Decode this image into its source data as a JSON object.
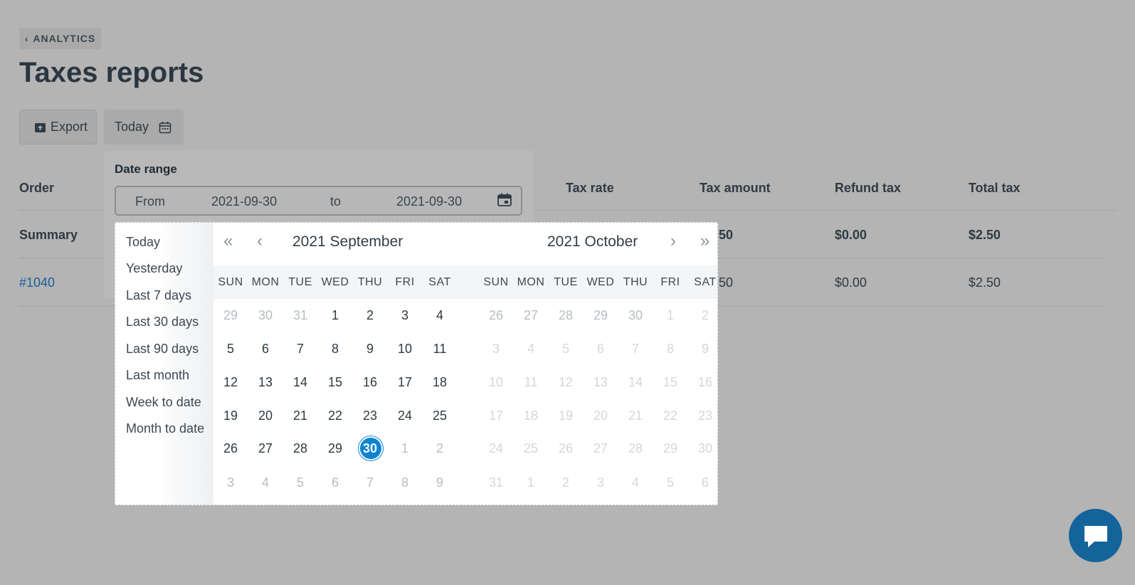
{
  "breadcrumb": {
    "label": "ANALYTICS"
  },
  "title": "Taxes reports",
  "toolbar": {
    "export_label": "Export",
    "date_button_label": "Today"
  },
  "table": {
    "headers": {
      "order": "Order",
      "tax_rate": "Tax rate",
      "tax_amount": "Tax amount",
      "refund_tax": "Refund tax",
      "total_tax": "Total tax"
    },
    "summary": {
      "label": "Summary",
      "tax_amount_partial": "50",
      "refund_tax": "$0.00",
      "total_tax": "$2.50"
    },
    "rows": [
      {
        "order": "#1040",
        "tax_amount_partial": "50",
        "refund_tax": "$0.00",
        "total_tax": "$2.50"
      }
    ]
  },
  "date_range": {
    "label": "Date range",
    "from_label": "From",
    "from_value": "2021-09-30",
    "to_label": "to",
    "to_value": "2021-09-30"
  },
  "presets": [
    "Today",
    "Yesterday",
    "Last 7 days",
    "Last 30 days",
    "Last 90 days",
    "Last month",
    "Week to date",
    "Month to date"
  ],
  "weekdays": [
    "SUN",
    "MON",
    "TUE",
    "WED",
    "THU",
    "FRI",
    "SAT"
  ],
  "calendar": {
    "left": {
      "title": "2021 September",
      "weeks": [
        [
          "29",
          "30",
          "31",
          "1",
          "2",
          "3",
          "4"
        ],
        [
          "5",
          "6",
          "7",
          "8",
          "9",
          "10",
          "11"
        ],
        [
          "12",
          "13",
          "14",
          "15",
          "16",
          "17",
          "18"
        ],
        [
          "19",
          "20",
          "21",
          "22",
          "23",
          "24",
          "25"
        ],
        [
          "26",
          "27",
          "28",
          "29",
          "30",
          "1",
          "2"
        ],
        [
          "3",
          "4",
          "5",
          "6",
          "7",
          "8",
          "9"
        ]
      ]
    },
    "right": {
      "title": "2021 October",
      "weeks": [
        [
          "26",
          "27",
          "28",
          "29",
          "30",
          "1",
          "2"
        ],
        [
          "3",
          "4",
          "5",
          "6",
          "7",
          "8",
          "9"
        ],
        [
          "10",
          "11",
          "12",
          "13",
          "14",
          "15",
          "16"
        ],
        [
          "17",
          "18",
          "19",
          "20",
          "21",
          "22",
          "23"
        ],
        [
          "24",
          "25",
          "26",
          "27",
          "28",
          "29",
          "30"
        ],
        [
          "31",
          "1",
          "2",
          "3",
          "4",
          "5",
          "6"
        ]
      ]
    },
    "selected_day": "30"
  },
  "colors": {
    "accent": "#0b84d1",
    "chat": "#14649c",
    "link": "#1b5e99"
  },
  "icons": {
    "back": "chevron-left-icon",
    "export": "export-icon",
    "calendar": "calendar-icon",
    "chat": "chat-icon"
  }
}
